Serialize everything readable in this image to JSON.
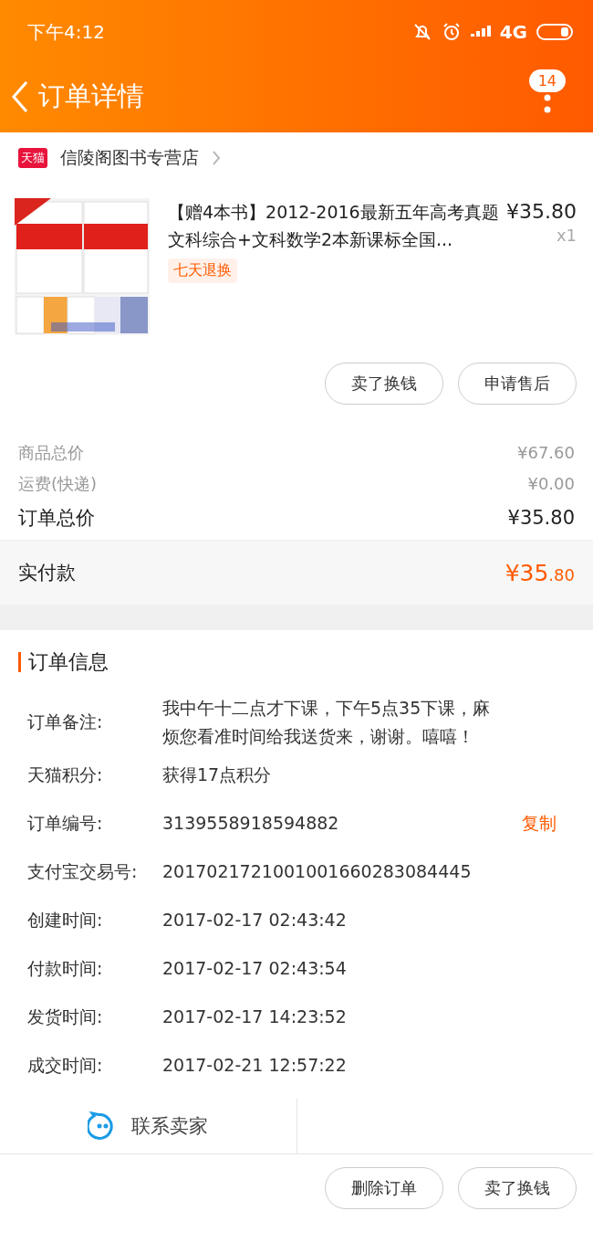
{
  "status_bar": {
    "time": "下午4:12",
    "network": "4G"
  },
  "header": {
    "title": "订单详情",
    "badge": "14"
  },
  "shop": {
    "name": "信陵阁图书专营店",
    "badge": "天猫"
  },
  "product": {
    "kind": "picture",
    "title": "【赠4本书】2012-2016最新五年高考真题文科综合+文科数学2本新课标全国...",
    "price": "¥35.80",
    "quantity": "x1",
    "tag": "七天退换"
  },
  "item_buttons": [
    "卖了换钱",
    "申请售后"
  ],
  "summary": [
    {
      "label": "商品总价",
      "value": "¥67.60",
      "kind": "minor"
    },
    {
      "label": "运费(快递)",
      "value": "¥0.00",
      "kind": "minor"
    },
    {
      "label": "订单总价",
      "value": "¥35.80",
      "kind": "major"
    }
  ],
  "paid": {
    "label": "实付款",
    "integer": "¥35",
    "decimal": ".80"
  },
  "order_info": {
    "title": "订单信息",
    "rows": [
      {
        "label": "订单备注:",
        "value": "我中午十二点才下课，下午5点35下课，麻烦您看准时间给我送货来，谢谢。嘻嘻！"
      },
      {
        "label": "天猫积分:",
        "value": "获得17点积分"
      },
      {
        "label": "订单编号:",
        "value": "3139558918594882",
        "action": "复制"
      },
      {
        "label": "支付宝交易号:",
        "value": "2017021721001001660283084445"
      },
      {
        "label": "创建时间:",
        "value": "2017-02-17 02:43:42"
      },
      {
        "label": "付款时间:",
        "value": "2017-02-17 02:43:54"
      },
      {
        "label": "发货时间:",
        "value": "2017-02-17 14:23:52"
      },
      {
        "label": "成交时间:",
        "value": "2017-02-21 12:57:22"
      }
    ]
  },
  "contact": {
    "label": "联系卖家"
  },
  "bottom_buttons": [
    "删除订单",
    "卖了换钱"
  ]
}
